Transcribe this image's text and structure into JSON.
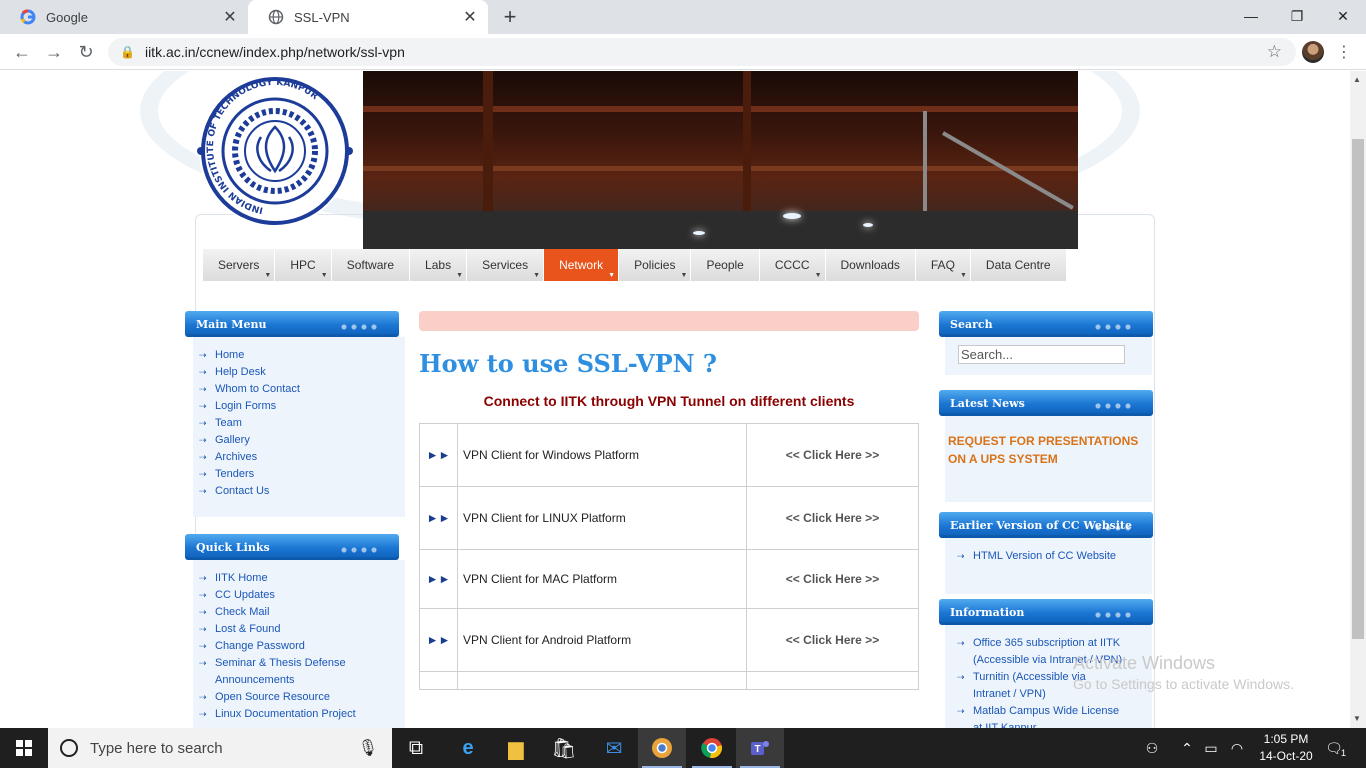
{
  "browser": {
    "tabs": [
      {
        "title": "Google",
        "active": false
      },
      {
        "title": "SSL-VPN",
        "active": true
      }
    ],
    "url": "iitk.ac.in/ccnew/index.php/network/ssl-vpn"
  },
  "site": {
    "logo_text": "INDIAN INSTITUTE OF TECHNOLOGY KANPUR",
    "nav": [
      {
        "label": "Servers",
        "dropdown": true
      },
      {
        "label": "HPC",
        "dropdown": true
      },
      {
        "label": "Software",
        "dropdown": false
      },
      {
        "label": "Labs",
        "dropdown": true
      },
      {
        "label": "Services",
        "dropdown": true
      },
      {
        "label": "Network",
        "dropdown": true,
        "active": true
      },
      {
        "label": "Policies",
        "dropdown": true
      },
      {
        "label": "People",
        "dropdown": false
      },
      {
        "label": "CCCC",
        "dropdown": true
      },
      {
        "label": "Downloads",
        "dropdown": false
      },
      {
        "label": "FAQ",
        "dropdown": true
      },
      {
        "label": "Data Centre",
        "dropdown": false
      }
    ],
    "main_menu": {
      "title": "Main Menu",
      "items": [
        "Home",
        "Help Desk",
        "Whom to Contact",
        "Login Forms",
        "Team",
        "Gallery",
        "Archives",
        "Tenders",
        "Contact Us"
      ]
    },
    "quick_links": {
      "title": "Quick Links",
      "items": [
        "IITK Home",
        "CC Updates",
        "Check Mail",
        "Lost & Found",
        "Change Password",
        "Seminar & Thesis Defense Announcements",
        "Open Source Resource",
        "Linux Documentation Project"
      ]
    },
    "content": {
      "title": "How to use SSL-VPN ?",
      "subtitle": "Connect to IITK through VPN Tunnel on different clients",
      "rows": [
        {
          "name": "VPN Client for Windows Platform",
          "link": "<< Click Here >>"
        },
        {
          "name": "VPN Client for LINUX Platform",
          "link": "<< Click Here >>"
        },
        {
          "name": "VPN Client for MAC Platform",
          "link": "<< Click Here >>"
        },
        {
          "name": "VPN Client for Android Platform",
          "link": "<< Click Here >>"
        }
      ]
    },
    "search": {
      "title": "Search",
      "placeholder": "Search..."
    },
    "latest_news": {
      "title": "Latest News",
      "items": [
        "REQUEST FOR PRESENTATIONS ON A UPS SYSTEM"
      ]
    },
    "earlier_version": {
      "title": "Earlier Version of CC Website",
      "items": [
        "HTML Version of CC Website"
      ]
    },
    "information": {
      "title": "Information",
      "items": [
        "Office 365 subscription at IITK (Accessible via Intranet / VPN)",
        "Turnitin (Accessible via Intranet / VPN)",
        "Matlab Campus Wide License at IIT Kanpur"
      ]
    }
  },
  "watermark": {
    "line1": "Activate Windows",
    "line2": "Go to Settings to activate Windows."
  },
  "taskbar": {
    "search_placeholder": "Type here to search",
    "time": "1:05 PM",
    "date": "14-Oct-20",
    "notification_count": "1"
  },
  "colors": {
    "nav_active": "#e8541c",
    "link_blue": "#1a57b8",
    "title_blue": "#2e8fe0",
    "subtitle_red": "#8b0000",
    "news_orange": "#d9731a"
  }
}
